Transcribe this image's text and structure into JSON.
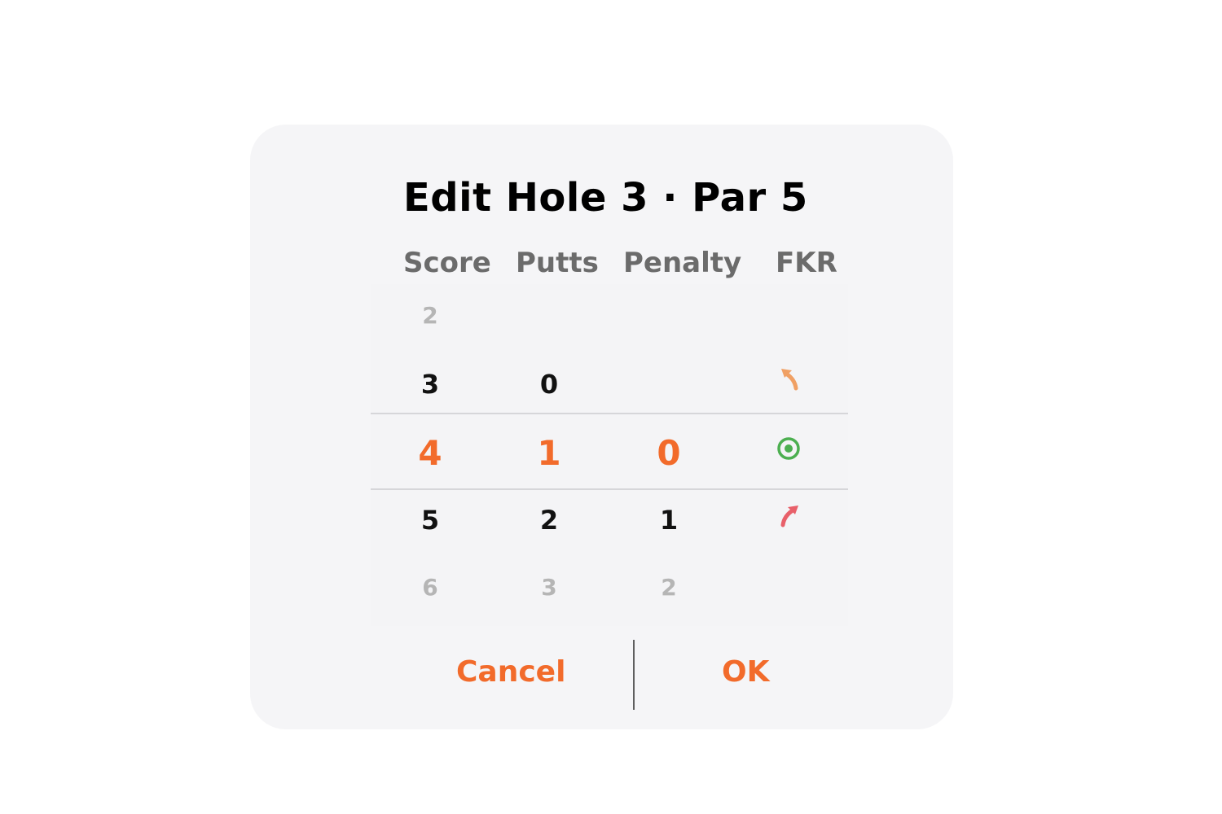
{
  "dialog": {
    "title": "Edit Hole 3 · Par 5",
    "headers": {
      "score": "Score",
      "putts": "Putts",
      "penalty": "Penalty",
      "fkr": "FKR"
    },
    "columns": {
      "score": {
        "above2": "2",
        "above1": "3",
        "selected": "4",
        "below1": "5",
        "below2": "6"
      },
      "putts": {
        "above1": "0",
        "selected": "1",
        "below1": "2",
        "below2": "3"
      },
      "penalty": {
        "selected": "0",
        "below1": "1",
        "below2": "2"
      },
      "fkr": {
        "above1_icon": "missed-left-arrow-icon",
        "selected_icon": "fairway-hit-target-icon",
        "below1_icon": "missed-right-arrow-icon"
      }
    },
    "buttons": {
      "cancel": "Cancel",
      "ok": "OK"
    },
    "colors": {
      "accent": "#f26b2b",
      "fkr_left": "#f0a064",
      "fkr_hit": "#4caf50",
      "fkr_right": "#e8606a"
    }
  }
}
